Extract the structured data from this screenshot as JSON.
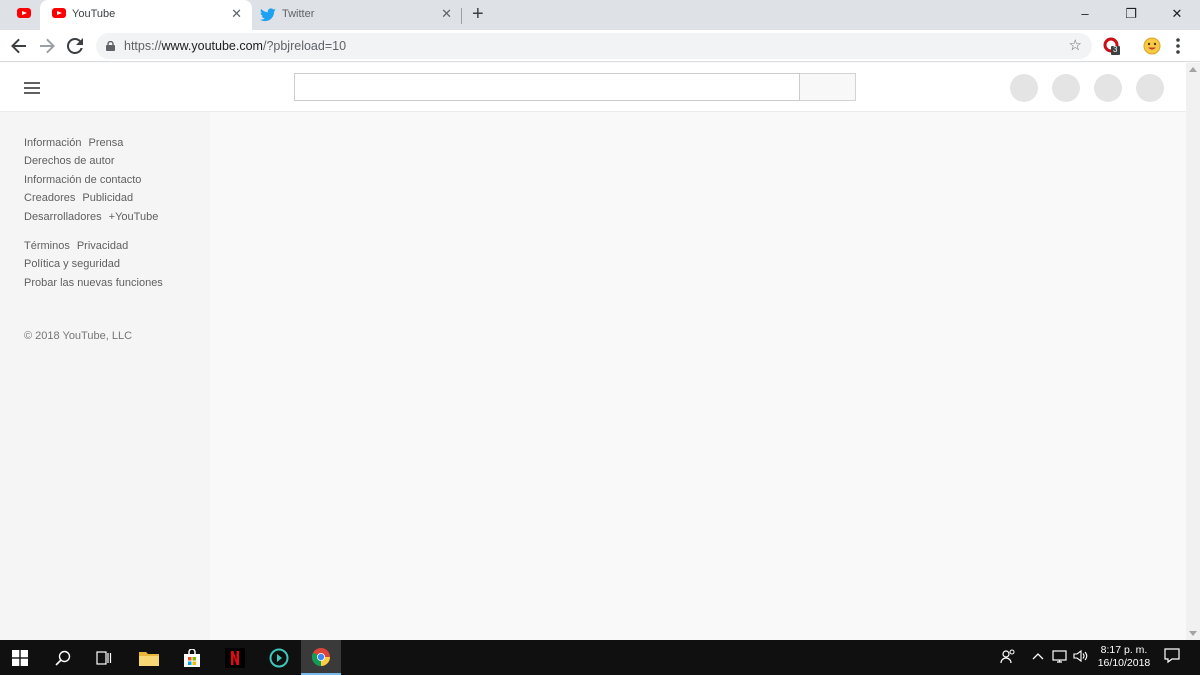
{
  "browser": {
    "tabs": [
      {
        "title": "YouTube",
        "close": "✕"
      },
      {
        "title": "Twitter",
        "close": "✕"
      }
    ],
    "new_tab": "+",
    "window_controls": {
      "minimize": "–",
      "restore": "❐",
      "close": "✕"
    },
    "address_bar": {
      "scheme": "https://",
      "host": "www.youtube.com",
      "path": "/?pbjreload=10"
    },
    "star": "☆",
    "extension_badge": "3"
  },
  "youtube": {
    "footer": {
      "row1": [
        "Información",
        "Prensa"
      ],
      "row2": [
        "Derechos de autor"
      ],
      "row3": [
        "Información de contacto"
      ],
      "row4": [
        "Creadores",
        "Publicidad"
      ],
      "row5": [
        "Desarrolladores",
        "+YouTube"
      ],
      "row6": [
        "Términos",
        "Privacidad"
      ],
      "row7": [
        "Política y seguridad"
      ],
      "row8": [
        "Probar las nuevas funciones"
      ]
    },
    "copyright": "© 2018 YouTube, LLC"
  },
  "taskbar": {
    "time": "8:17 p. m.",
    "date": "16/10/2018"
  },
  "colors": {
    "youtube_red": "#ff0000",
    "twitter_blue": "#1da1f2",
    "taskbar": "#101010"
  }
}
